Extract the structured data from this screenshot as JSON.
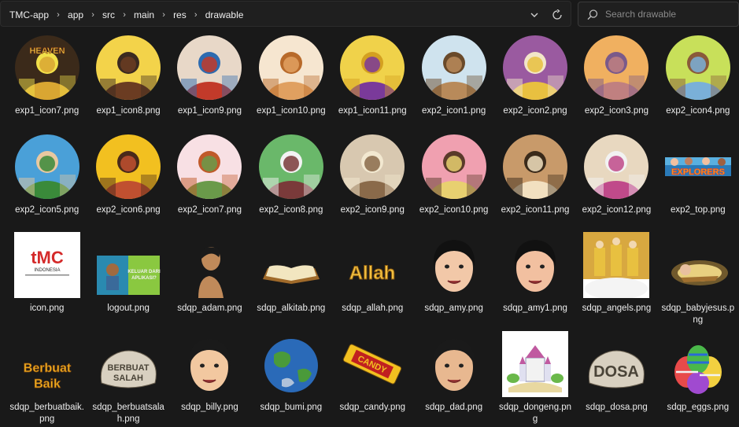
{
  "breadcrumb": [
    "TMC-app",
    "app",
    "src",
    "main",
    "res",
    "drawable"
  ],
  "search": {
    "placeholder": "Search drawable"
  },
  "files": [
    {
      "name": "exp1_icon7.png",
      "kind": "circle",
      "bg": "#3b2a1a",
      "fg": "#d9a632",
      "accent": "#f2e04a",
      "text": "HEAVEN"
    },
    {
      "name": "exp1_icon8.png",
      "kind": "circle",
      "bg": "#f3d34a",
      "fg": "#6b3c22",
      "accent": "#3b2a20"
    },
    {
      "name": "exp1_icon9.png",
      "kind": "circle",
      "bg": "#e8d8c8",
      "fg": "#c23a2a",
      "accent": "#2d6bb0"
    },
    {
      "name": "exp1_icon10.png",
      "kind": "circle",
      "bg": "#f6e6d0",
      "fg": "#e0a060",
      "accent": "#b86a2a"
    },
    {
      "name": "exp1_icon11.png",
      "kind": "circle",
      "bg": "#f0d24a",
      "fg": "#7a3a9a",
      "accent": "#d4a020"
    },
    {
      "name": "exp2_icon1.png",
      "kind": "circle",
      "bg": "#cfe3ee",
      "fg": "#b88a5a",
      "accent": "#6a4a2a"
    },
    {
      "name": "exp2_icon2.png",
      "kind": "circle",
      "bg": "#9a5aa0",
      "fg": "#e8c040",
      "accent": "#f2e6c8"
    },
    {
      "name": "exp2_icon3.png",
      "kind": "circle",
      "bg": "#f0b060",
      "fg": "#c08080",
      "accent": "#7a5a8a"
    },
    {
      "name": "exp2_icon4.png",
      "kind": "circle",
      "bg": "#c8e05a",
      "fg": "#7ab0d8",
      "accent": "#8a5a3a"
    },
    {
      "name": "exp2_icon5.png",
      "kind": "circle",
      "bg": "#4aa0d8",
      "fg": "#3a8a3a",
      "accent": "#e8c8a0"
    },
    {
      "name": "exp2_icon6.png",
      "kind": "circle",
      "bg": "#f2c020",
      "fg": "#c05030",
      "accent": "#4a2a1a"
    },
    {
      "name": "exp2_icon7.png",
      "kind": "circle",
      "bg": "#f8e0e4",
      "fg": "#6a9a4a",
      "accent": "#c05a2a"
    },
    {
      "name": "exp2_icon8.png",
      "kind": "circle",
      "bg": "#6ab86a",
      "fg": "#7a3a3a",
      "accent": "#f2f2f2"
    },
    {
      "name": "exp2_icon9.png",
      "kind": "circle",
      "bg": "#d8c8b0",
      "fg": "#8a6a4a",
      "accent": "#f2e8d0"
    },
    {
      "name": "exp2_icon10.png",
      "kind": "circle",
      "bg": "#f0a0b0",
      "fg": "#e8d070",
      "accent": "#5a3a2a"
    },
    {
      "name": "exp2_icon11.png",
      "kind": "circle",
      "bg": "#c89a6a",
      "fg": "#f2e0c0",
      "accent": "#3a2a1a"
    },
    {
      "name": "exp2_icon12.png",
      "kind": "circle",
      "bg": "#e8d8c0",
      "fg": "#c04a8a",
      "accent": "#f2f2f2"
    },
    {
      "name": "exp2_top.png",
      "kind": "banner",
      "bg": "#2a7ab8",
      "fg": "#f2b020",
      "accent": "#e84a2a",
      "text": "EXPLORERS"
    },
    {
      "name": "icon.png",
      "kind": "logo",
      "bg": "#ffffff",
      "fg": "#d42a2a",
      "accent": "#2a2a2a",
      "text": "tMC",
      "sub": "INDONESIA"
    },
    {
      "name": "logout.png",
      "kind": "poster",
      "bg": "#8ac840",
      "fg": "#2a8ab0",
      "accent": "#f2f2f2",
      "text": "KELUAR DARI APLIKASI?"
    },
    {
      "name": "sdqp_adam.png",
      "kind": "figure",
      "bg": "#191919",
      "fg": "#c08a5a",
      "accent": "#1a1a1a"
    },
    {
      "name": "sdqp_alkitab.png",
      "kind": "book",
      "bg": "#191919",
      "fg": "#f2e6c0",
      "accent": "#a06a2a"
    },
    {
      "name": "sdqp_allah.png",
      "kind": "word",
      "bg": "#191919",
      "fg": "#f2c040",
      "accent": "#8a5a10",
      "text": "Allah"
    },
    {
      "name": "sdqp_amy.png",
      "kind": "face",
      "bg": "#191919",
      "fg": "#f2c8a8",
      "accent": "#111111"
    },
    {
      "name": "sdqp_amy1.png",
      "kind": "face",
      "bg": "#191919",
      "fg": "#f2c0a0",
      "accent": "#111111"
    },
    {
      "name": "sdqp_angels.png",
      "kind": "angels",
      "bg": "#ffffff",
      "fg": "#e8c040",
      "accent": "#c08020"
    },
    {
      "name": "sdqp_babyjesus.png",
      "kind": "baby",
      "bg": "#191919",
      "fg": "#e8d080",
      "accent": "#a07030"
    },
    {
      "name": "sdqp_berbuatbaik.png",
      "kind": "word2",
      "bg": "#191919",
      "fg": "#f2b020",
      "accent": "#8a5010",
      "text": "Berbuat",
      "text2": "Baik"
    },
    {
      "name": "sdqp_berbuatsalah.png",
      "kind": "rock",
      "bg": "#191919",
      "fg": "#d8d0c0",
      "accent": "#6a6050",
      "text": "BERBUAT",
      "text2": "SALAH"
    },
    {
      "name": "sdqp_billy.png",
      "kind": "face",
      "bg": "#191919",
      "fg": "#f2c8a0",
      "accent": "#1a1a1a"
    },
    {
      "name": "sdqp_bumi.png",
      "kind": "globe",
      "bg": "#191919",
      "fg": "#2a6ab8",
      "accent": "#4a9a3a"
    },
    {
      "name": "sdqp_candy.png",
      "kind": "candy",
      "bg": "#191919",
      "fg": "#f2c020",
      "accent": "#c02020",
      "text": "CANDY"
    },
    {
      "name": "sdqp_dad.png",
      "kind": "face",
      "bg": "#191919",
      "fg": "#e8b890",
      "accent": "#1a1a1a"
    },
    {
      "name": "sdqp_dongeng.png",
      "kind": "castle",
      "bg": "#ffffff",
      "fg": "#c05aa0",
      "accent": "#6ab84a"
    },
    {
      "name": "sdqp_dosa.png",
      "kind": "rock",
      "bg": "#191919",
      "fg": "#d8d0c0",
      "accent": "#6a6050",
      "text": "DOSA",
      "text2": ""
    },
    {
      "name": "sdqp_eggs.png",
      "kind": "eggs",
      "bg": "#191919",
      "fg": "#e84a4a",
      "accent": "#4ab84a"
    }
  ]
}
